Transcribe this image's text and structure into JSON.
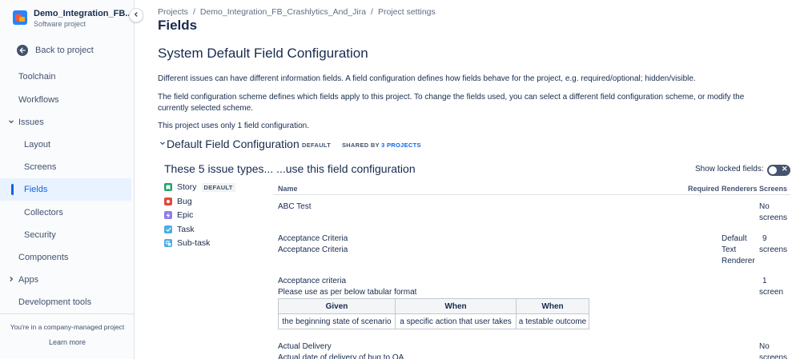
{
  "sidebar": {
    "project_name": "Demo_Integration_FB...",
    "project_type": "Software project",
    "back_label": "Back to project",
    "items": [
      {
        "label": "Toolchain"
      },
      {
        "label": "Workflows"
      },
      {
        "label": "Issues"
      },
      {
        "label": "Layout"
      },
      {
        "label": "Screens"
      },
      {
        "label": "Fields"
      },
      {
        "label": "Collectors"
      },
      {
        "label": "Security"
      },
      {
        "label": "Components"
      },
      {
        "label": "Apps"
      },
      {
        "label": "Development tools"
      }
    ],
    "company_note": "You're in a company-managed project",
    "learn_more": "Learn more"
  },
  "breadcrumb": [
    "Projects",
    "Demo_Integration_FB_Crashlytics_And_Jira",
    "Project settings"
  ],
  "page_title": "Fields",
  "config_title": "System Default Field Configuration",
  "paragraphs": {
    "p1": "Different issues can have different information fields. A field configuration defines how fields behave for the project, e.g. required/optional; hidden/visible.",
    "p2": "The field configuration scheme defines which fields apply to this project. To change the fields used, you can select a different field configuration scheme, or modify the currently selected scheme.",
    "p3": "This project uses only 1 field configuration."
  },
  "field_config": {
    "title": "Default Field Configuration",
    "default_badge": "DEFAULT",
    "shared_prefix": "SHARED BY",
    "shared_link": "3 PROJECTS"
  },
  "issue_types_heading": "These 5 issue types... ...use this field configuration",
  "show_locked_label": "Show locked fields:",
  "issue_types": [
    {
      "label": "Story",
      "badge": "DEFAULT",
      "color": "#22a06b"
    },
    {
      "label": "Bug",
      "color": "#e5493a"
    },
    {
      "label": "Epic",
      "color": "#8f7ee7"
    },
    {
      "label": "Task",
      "color": "#4bade8"
    },
    {
      "label": "Sub-task",
      "color": "#4bade8"
    }
  ],
  "table": {
    "headers": {
      "name": "Name",
      "required": "Required",
      "renderers": "Renderers",
      "screens": "Screens"
    },
    "rows": [
      {
        "name": "ABC Test",
        "screens_1": "No",
        "screens_2": "screens"
      },
      {
        "name": "Acceptance Criteria",
        "desc": "Acceptance Criteria",
        "renderer_1": "Default",
        "renderer_2": "Text",
        "renderer_3": "Renderer",
        "screens_1": "9",
        "screens_2": "screens"
      },
      {
        "name": "Acceptance criteria",
        "desc": "Please use as per below tabular format",
        "screens_1": "1",
        "screens_2": "screen"
      },
      {
        "name": "Actual Delivery",
        "desc": "Actual date of delivery of bug to QA",
        "screens_1": "No",
        "screens_2": "screens"
      }
    ],
    "inner_table": {
      "headers": [
        "Given",
        "When",
        "When"
      ],
      "cells": [
        "the beginning state of scenario",
        "a specific action that user takes",
        "a testable outcome"
      ]
    }
  }
}
